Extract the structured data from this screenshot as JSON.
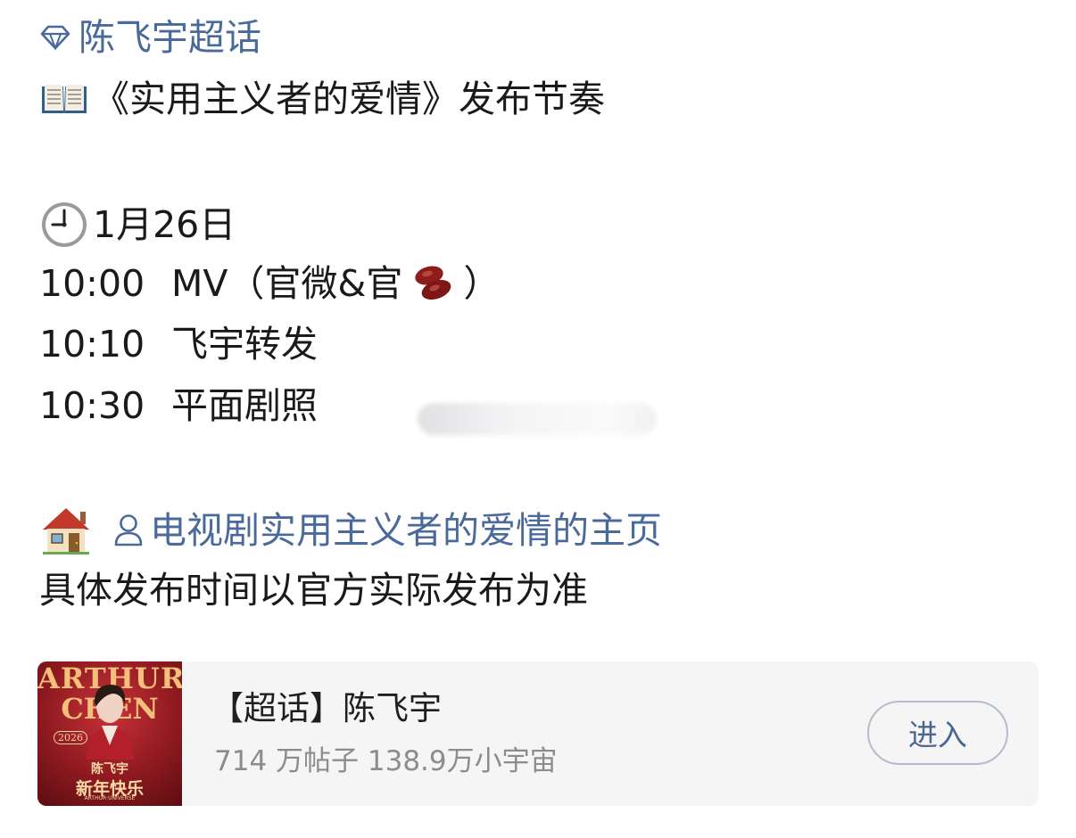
{
  "topic_link": {
    "label": "陈飞宇超话",
    "icon": "diamond-icon",
    "color": "#4a6a9c"
  },
  "headline": {
    "icon": "open-book-icon",
    "text": "《实用主义者的爱情》发布节奏"
  },
  "schedule": {
    "date_icon": "clock-icon",
    "date": "1月26日",
    "items": [
      {
        "time": "10:00",
        "label": "MV（官微&官",
        "suffix_icon": "bean-icon",
        "suffix": "）"
      },
      {
        "time": "10:10",
        "label": "飞宇转发"
      },
      {
        "time": "10:30",
        "label": "平面剧照"
      }
    ]
  },
  "homepage": {
    "house_icon": "house-icon",
    "user_icon": "user-icon",
    "link_label": "电视剧实用主义者的爱情的主页"
  },
  "note": "具体发布时间以官方实际发布为准",
  "supertopic_card": {
    "cover": {
      "title_line1": "ARTHUR",
      "title_line2": "CHEN",
      "year": "2026",
      "name": "陈飞宇",
      "greeting": "新年快乐",
      "small": "ARTHUR·UNIVERSE"
    },
    "title": "【超话】陈飞宇",
    "stats": "714 万帖子 138.9万小宇宙",
    "enter_label": "进入"
  },
  "colors": {
    "link": "#4a6a9c",
    "text": "#1a1a1a",
    "muted": "#8c8c8c",
    "card_bg": "#f5f5f6",
    "button_border": "#b3bdcc"
  }
}
